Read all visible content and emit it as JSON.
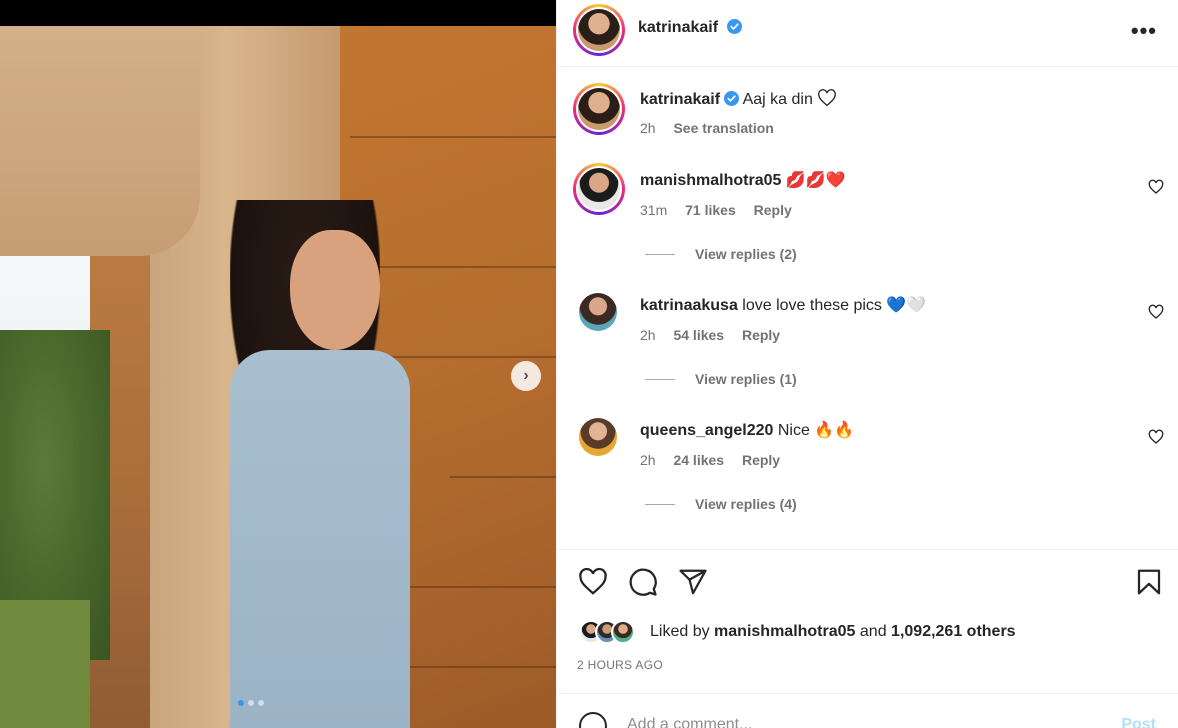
{
  "post": {
    "username": "katrinakaif",
    "caption": "Aaj ka din",
    "caption_time": "2h",
    "see_translation": "See translation"
  },
  "comments": [
    {
      "username": "manishmalhotra05",
      "text": "",
      "emojis": "💋💋❤️",
      "time": "31m",
      "likes": "71 likes",
      "reply": "Reply",
      "view_replies": "View replies (2)"
    },
    {
      "username": "katrinaakusa",
      "text": "love love these pics",
      "emojis": "💙🤍",
      "time": "2h",
      "likes": "54 likes",
      "reply": "Reply",
      "view_replies": "View replies (1)"
    },
    {
      "username": "queens_angel220",
      "text": "Nice",
      "emojis": "🔥🔥",
      "time": "2h",
      "likes": "24 likes",
      "reply": "Reply",
      "view_replies": "View replies (4)"
    }
  ],
  "likes": {
    "prefix": "Liked by",
    "user": "manishmalhotra05",
    "and": "and",
    "others": "1,092,261 others"
  },
  "timestamp": "2 HOURS AGO",
  "add_comment_placeholder": "Add a comment...",
  "post_button": "Post",
  "more_label": "•••",
  "icons": {
    "verified": "verified-badge-icon",
    "like": "heart-icon",
    "comment": "comment-icon",
    "share": "share-icon",
    "save": "bookmark-icon",
    "next": "chevron-right-icon",
    "emoji": "emoji-icon"
  },
  "colors": {
    "verified": "#3897f0",
    "text": "#262626",
    "secondary": "#737373",
    "post_button": "#b2dffc"
  }
}
